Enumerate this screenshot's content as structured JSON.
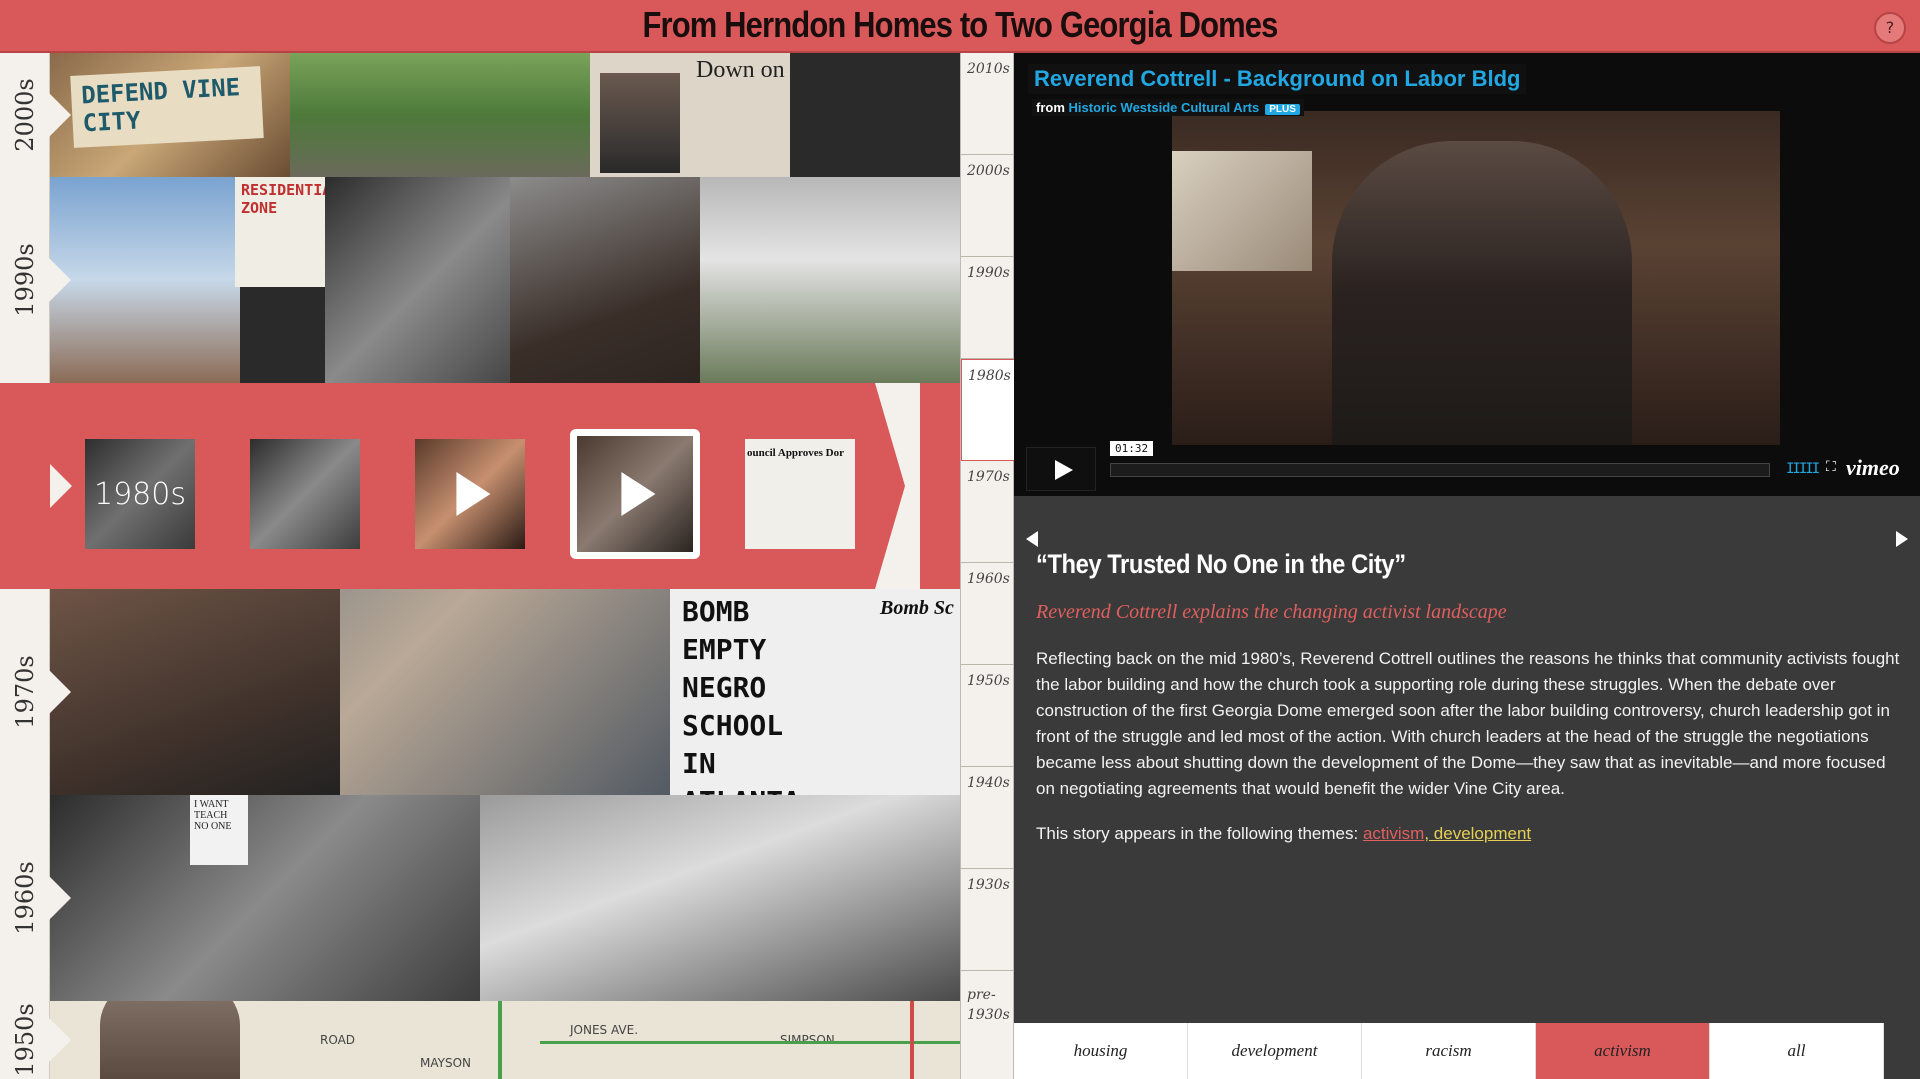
{
  "header": {
    "title": "From Herndon Homes to Two Georgia Domes",
    "help_label": "?"
  },
  "decades": [
    {
      "id": "2000",
      "label": "2000s"
    },
    {
      "id": "1990",
      "label": "1990s"
    },
    {
      "id": "1980",
      "label": "1980s"
    },
    {
      "id": "1970",
      "label": "1970s"
    },
    {
      "id": "1960",
      "label": "1960s"
    },
    {
      "id": "1950",
      "label": "1950s"
    }
  ],
  "collage_text": {
    "defend": "DEFEND VINE CITY",
    "down": "Down on",
    "residential": "RESIDENTIAL ZONE",
    "bomb": "BOMB EMPTY NEGRO SCHOOL IN ATLANTA",
    "bomb_sc": "Bomb Sc",
    "council": "ouncil Approves Dor",
    "sign": "I WANT TEACH NO ONE",
    "map_jones": "JONES AVE.",
    "map_simpson": "SIMPSON",
    "map_road": "ROAD",
    "map_mayson": "MAYSON"
  },
  "band_1980": {
    "thumbs": [
      {
        "name": "decade-intro-thumb",
        "label": "1980s",
        "video": false
      },
      {
        "name": "photo-thumb",
        "label": "",
        "video": false
      },
      {
        "name": "video-thumb",
        "label": "",
        "video": true
      },
      {
        "name": "video-thumb-selected",
        "label": "",
        "video": true
      },
      {
        "name": "newspaper-thumb",
        "label": "",
        "video": false
      }
    ]
  },
  "ruler": {
    "ticks": [
      "2010s",
      "2000s",
      "1990s",
      "1980s",
      "1970s",
      "1960s",
      "1950s",
      "1940s",
      "1930s",
      "pre-1930s"
    ],
    "active": "1980s"
  },
  "video": {
    "title": "Reverend Cottrell - Background on Labor Bldg",
    "from_label": "from",
    "source": "Historic Westside Cultural Arts",
    "plus": "PLUS",
    "time": "01:32",
    "brand": "vimeo",
    "volume_glyph": "IIIII",
    "fullscreen_glyph": "⛶"
  },
  "story": {
    "title": "“They Trusted No One in the City”",
    "subtitle": "Reverend Cottrell explains the changing activist landscape",
    "body": "Reflecting back on the mid 1980’s, Reverend Cottrell outlines the reasons he thinks that community activists fought the labor building and how the church took a supporting role during these struggles. When the debate over construction of the first Georgia Dome emerged soon after the labor building controversy, church leadership got in front of the struggle and led most of the action. With church leaders at the head of the struggle the negotiations became less about shutting down the development of the Dome—they saw that as inevitable—and more focused on negotiating agreements that would benefit the wider Vine City area.",
    "themes_prefix": "This story appears in the following themes: ",
    "theme_1": "activism",
    "theme_2": ", development"
  },
  "tabs": [
    {
      "label": "housing",
      "active": false
    },
    {
      "label": "development",
      "active": false
    },
    {
      "label": "racism",
      "active": false
    },
    {
      "label": "activism",
      "active": true
    },
    {
      "label": "all",
      "active": false
    }
  ],
  "colors": {
    "accent": "#d9595a",
    "link_blue": "#21a8e3",
    "theme_yellow": "#e5cf55"
  }
}
